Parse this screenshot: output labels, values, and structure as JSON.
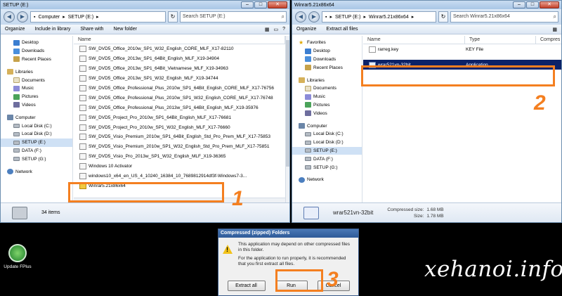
{
  "left_window": {
    "title": "SETUP (E:)",
    "breadcrumb": [
      "Computer",
      "SETUP (E:)"
    ],
    "search_placeholder": "Search SETUP (E:)",
    "toolbar": {
      "organize": "Organize",
      "include": "Include in library",
      "share": "Share with",
      "new_folder": "New folder"
    },
    "nav": {
      "desktop": "Desktop",
      "downloads": "Downloads",
      "recent": "Recent Places",
      "libraries": "Libraries",
      "documents": "Documents",
      "music": "Music",
      "pictures": "Pictures",
      "videos": "Videos",
      "computer": "Computer",
      "local_c": "Local Disk (C:)",
      "local_d": "Local Disk (D:)",
      "setup_e": "SETUP (E:)",
      "data_f": "DATA (F:)",
      "setup_g": "SETUP (G:)",
      "network": "Network"
    },
    "column_name": "Name",
    "files": [
      "SW_DVD5_Office_2010w_SP1_W32_English_CORE_MLF_X17-82110",
      "SW_DVD5_Office_2013w_SP1_64Bit_English_MLF_X19-34904",
      "SW_DVD5_Office_2013w_SP1_64Bit_Vietnamese_MLF_X19-34963",
      "SW_DVD5_Office_2013w_SP1_W32_English_MLF_X19-34744",
      "SW_DVD5_Office_Professional_Plus_2010w_SP1_64Bit_English_CORE_MLF_X17-76756",
      "SW_DVD5_Office_Professional_Plus_2010w_SP1_W32_English_CORE_MLF_X17-76748",
      "SW_DVD5_Office_Professional_Plus_2013w_SP1_64Bit_English_MLF_X19-35976",
      "SW_DVD5_Project_Pro_2010w_SP1_64Bit_English_MLF_X17-76681",
      "SW_DVD5_Project_Pro_2010w_SP1_W32_English_MLF_X17-76660",
      "SW_DVD5_Visio_Premium_2010w_SP1_64Bit_English_Std_Pro_Prem_MLF_X17-75853",
      "SW_DVD5_Visio_Premium_2010w_SP1_W32_English_Std_Pro_Prem_MLF_X17-75851",
      "SW_DVD5_Visio_Pro_2013w_SP1_W32_English_MLF_X19-36365",
      "Windows 10 Activator",
      "windows10_x64_en_US_4_10240_16384_10_7689812914df3f-Windows7-3..."
    ],
    "zip_file": "Winrar5.21x86x64",
    "item_count": "34 items"
  },
  "right_window": {
    "title": "Winrar5.21x86x64",
    "breadcrumb": [
      "SETUP (E:)",
      "Winrar5.21x86x64"
    ],
    "search_placeholder": "Search Winrar5.21x86x64",
    "toolbar": {
      "organize": "Organize",
      "extract": "Extract all files"
    },
    "nav": {
      "favorites": "Favorites",
      "desktop": "Desktop",
      "downloads": "Downloads",
      "recent": "Recent Places",
      "libraries": "Libraries",
      "documents": "Documents",
      "music": "Music",
      "pictures": "Pictures",
      "videos": "Videos",
      "computer": "Computer",
      "local_c": "Local Disk (C:)",
      "local_d": "Local Disk (D:)",
      "setup_e": "SETUP (E:)",
      "data_f": "DATA (F:)",
      "setup_g": "SETUP (G:)",
      "network": "Network"
    },
    "columns": {
      "name": "Name",
      "type": "Type",
      "compressed": "Compres"
    },
    "files": [
      {
        "name": "rarreg.key",
        "type": "KEY File"
      },
      {
        "name": "wrar521vn-32bit",
        "type": "Application"
      }
    ],
    "details": {
      "name": "wrar521vn-32bit",
      "compressed_label": "Compressed size:",
      "compressed_value": "1.68 MB",
      "size_label": "Size:",
      "size_value": "1.78 MB"
    }
  },
  "dialog": {
    "title": "Compressed (zipped) Folders",
    "message1": "This application may depend on other compressed files in this folder.",
    "message2": "For the application to run properly, it is recommended that you first extract all files.",
    "btn_extract": "Extract all",
    "btn_run": "Run",
    "btn_cancel": "Cancel"
  },
  "desktop_icon": "Update FPlus",
  "watermark": "xehanoi.info",
  "step_labels": [
    "1",
    "2",
    "3"
  ],
  "accent_color": "#f47f20"
}
